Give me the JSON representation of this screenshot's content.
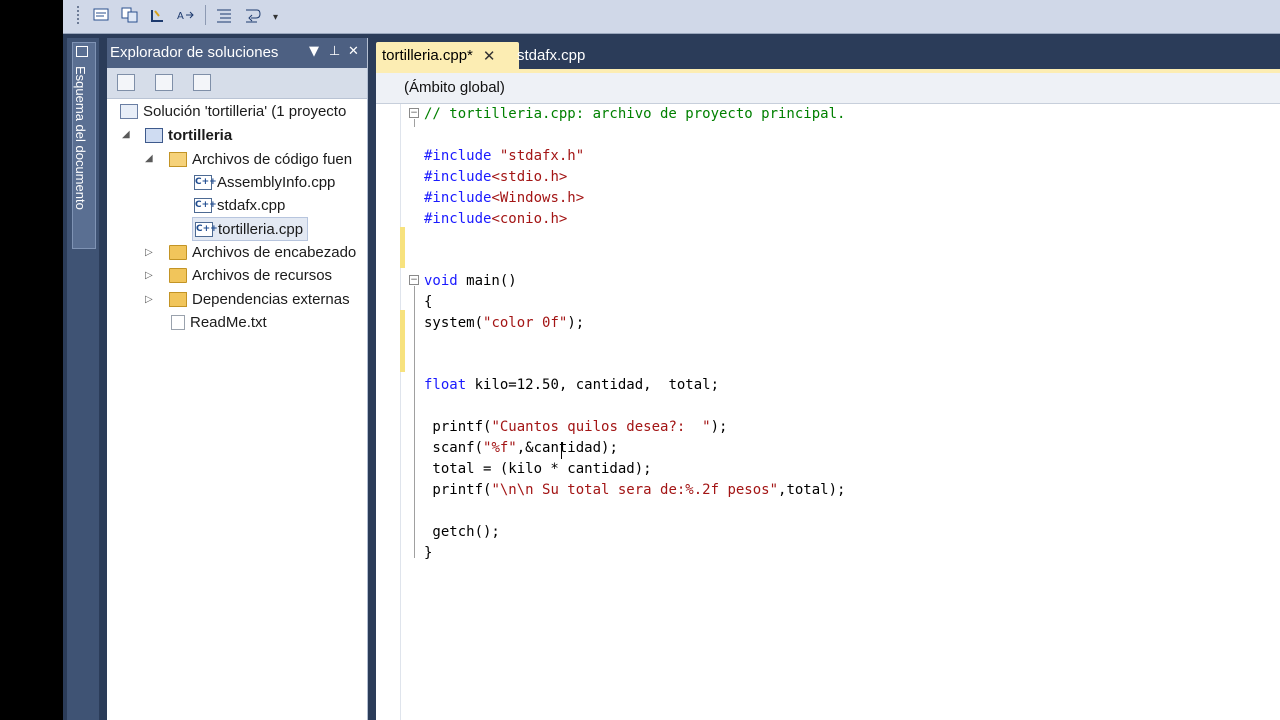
{
  "toolbar": {
    "buttons": [
      "properties-icon",
      "show-all-files-icon",
      "refresh-icon",
      "rename-icon",
      "outline-icon",
      "wrap-icon"
    ]
  },
  "doc_outline": {
    "label": "Esquema del documento"
  },
  "solution_explorer": {
    "title": "Explorador de soluciones",
    "header_buttons": [
      "▼",
      "⊥",
      "✕"
    ],
    "tree": [
      {
        "label": "Solución 'tortilleria' (1 proyecto",
        "icon": "solution-icon",
        "level": 0
      },
      {
        "label": "tortilleria",
        "icon": "project-icon",
        "level": 1,
        "expanded": true,
        "bold": true
      },
      {
        "label": "Archivos de código fuen",
        "icon": "folder-open-icon",
        "level": 2,
        "expanded": true
      },
      {
        "label": "AssemblyInfo.cpp",
        "icon": "cpp-file-icon",
        "level": 3
      },
      {
        "label": "stdafx.cpp",
        "icon": "cpp-file-icon",
        "level": 3
      },
      {
        "label": "tortilleria.cpp",
        "icon": "cpp-file-icon",
        "level": 3,
        "selected": true
      },
      {
        "label": "Archivos de encabezado",
        "icon": "folder-icon",
        "level": 2,
        "expanded": false
      },
      {
        "label": "Archivos de recursos",
        "icon": "folder-icon",
        "level": 2,
        "expanded": false
      },
      {
        "label": "Dependencias externas",
        "icon": "dependencies-icon",
        "level": 2,
        "expanded": false
      },
      {
        "label": "ReadMe.txt",
        "icon": "text-file-icon",
        "level": 2
      }
    ]
  },
  "editor": {
    "tabs": [
      {
        "label": "tortilleria.cpp*",
        "active": true
      },
      {
        "label": "stdafx.cpp",
        "active": false
      }
    ],
    "scope": "(Ámbito global)",
    "code": {
      "l1": "// tortilleria.cpp: archivo de proyecto principal.",
      "l3a": "#include ",
      "l3b": "\"stdafx.h\"",
      "l4a": "#include",
      "l4b": "<stdio.h>",
      "l5a": "#include",
      "l5b": "<Windows.h>",
      "l6a": "#include",
      "l6b": "<conio.h>",
      "l9a": "void",
      "l9b": " main()",
      "l10": "{",
      "l11a": "system(",
      "l11b": "\"color 0f\"",
      "l11c": ");",
      "l14a": "float",
      "l14b": " kilo=12.50, cantidad,  total;",
      "l16a": " printf(",
      "l16b": "\"Cuantos quilos desea?:  \"",
      "l16c": ");",
      "l17a": " scanf(",
      "l17b": "\"%f\"",
      "l17c": ",&cantidad);",
      "l18": " total = (kilo * cantidad);",
      "l19a": " printf(",
      "l19b": "\"\\n\\n Su total sera de:%.2f pesos\"",
      "l19c": ",total);",
      "l21": " getch();",
      "l22": "}"
    }
  }
}
